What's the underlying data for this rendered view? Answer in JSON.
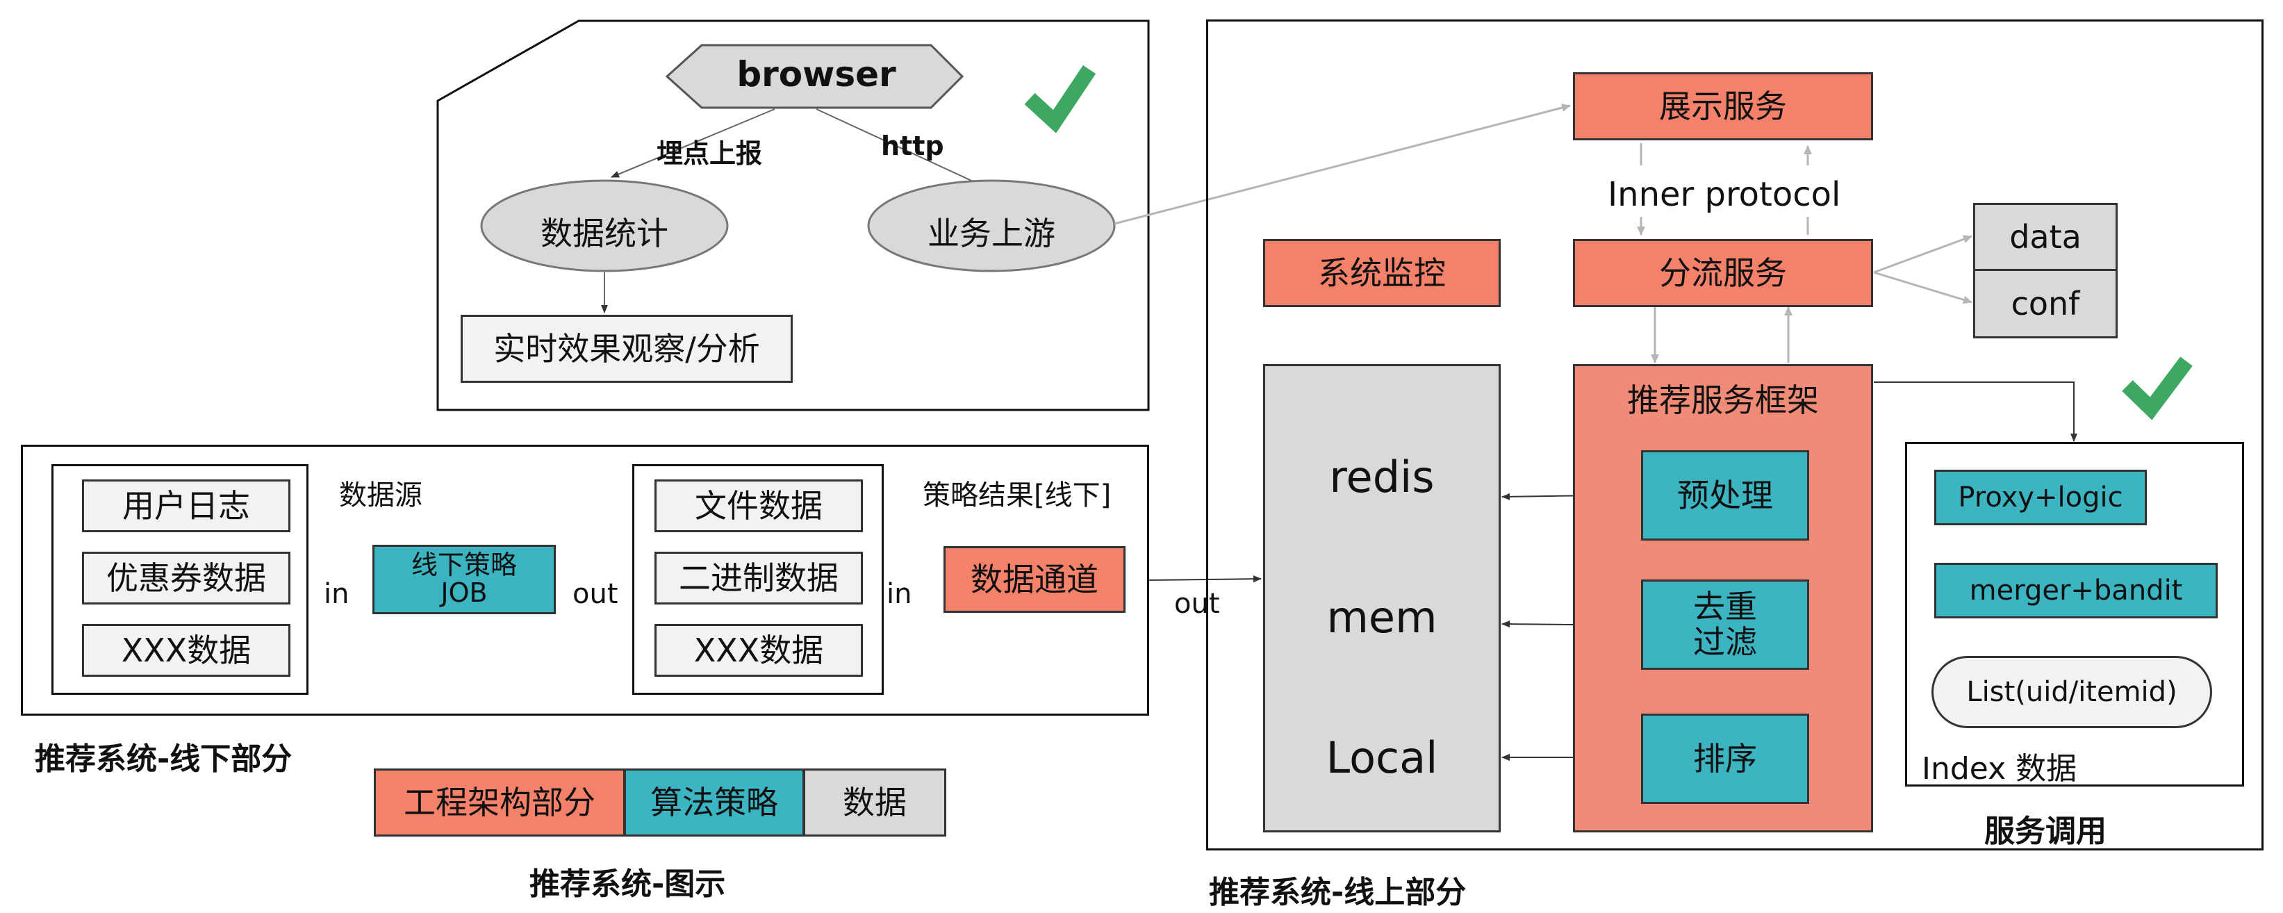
{
  "top_panel": {
    "browser": "browser",
    "edge_left": "埋点上报",
    "edge_right": "http",
    "node_stats": "数据统计",
    "node_upstream": "业务上游",
    "node_realtime": "实时效果观察/分析"
  },
  "offline": {
    "sources": [
      "用户日志",
      "优惠券数据",
      "XXX数据"
    ],
    "sources_title": "数据源",
    "in1": "in",
    "job_line1": "线下策略",
    "job_line2": "JOB",
    "out1": "out",
    "results": [
      "文件数据",
      "二进制数据",
      "XXX数据"
    ],
    "results_title": "策略结果[线下]",
    "in2": "in",
    "channel": "数据通道",
    "out2": "out",
    "caption": "推荐系统-线下部分"
  },
  "legend": {
    "items": [
      "工程架构部分",
      "算法策略",
      "数据"
    ],
    "caption": "推荐系统-图示"
  },
  "online": {
    "display": "展示服务",
    "inner_protocol": "Inner protocol",
    "monitor": "系统监控",
    "split": "分流服务",
    "data": "data",
    "conf": "conf",
    "storage": [
      "redis",
      "mem",
      "Local"
    ],
    "framework": "推荐服务框架",
    "preprocess": "预处理",
    "dedup_line1": "去重",
    "dedup_line2": "过滤",
    "sort": "排序",
    "proxy": "Proxy+logic",
    "merger": "merger+bandit",
    "list": "List(uid/itemid)",
    "index": "Index 数据",
    "service_caption": "服务调用",
    "caption": "推荐系统-线上部分"
  },
  "colors": {
    "engineering": "#f4826b",
    "algorithm": "#3cb4c2",
    "data": "#d9d9d9",
    "check": "#3ea862"
  }
}
